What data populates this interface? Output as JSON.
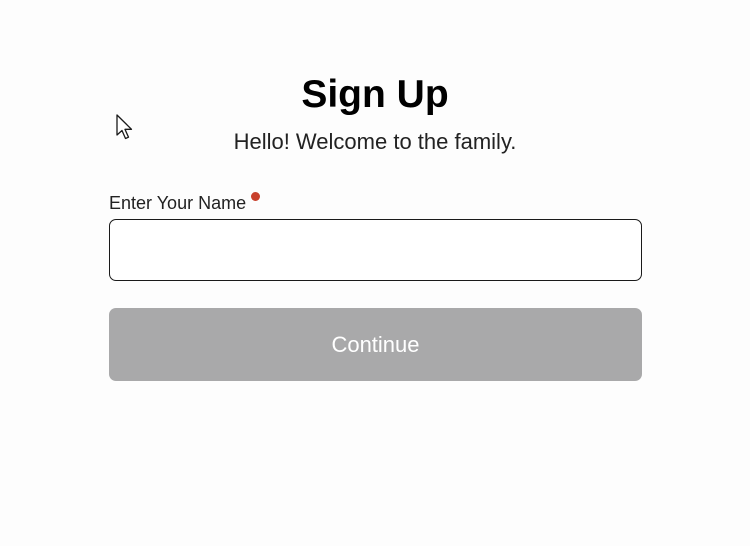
{
  "header": {
    "title": "Sign Up",
    "subtitle": "Hello! Welcome to the family."
  },
  "form": {
    "name_label": "Enter Your Name",
    "name_value": "",
    "name_placeholder": "",
    "name_required": true,
    "continue_label": "Continue",
    "continue_disabled": true
  },
  "colors": {
    "required_dot": "#c8402c",
    "button_disabled_bg": "#a9a9aa",
    "button_text": "#ffffff"
  },
  "icons": {
    "cursor": "mouse-pointer-arrow",
    "required": "required-dot"
  }
}
